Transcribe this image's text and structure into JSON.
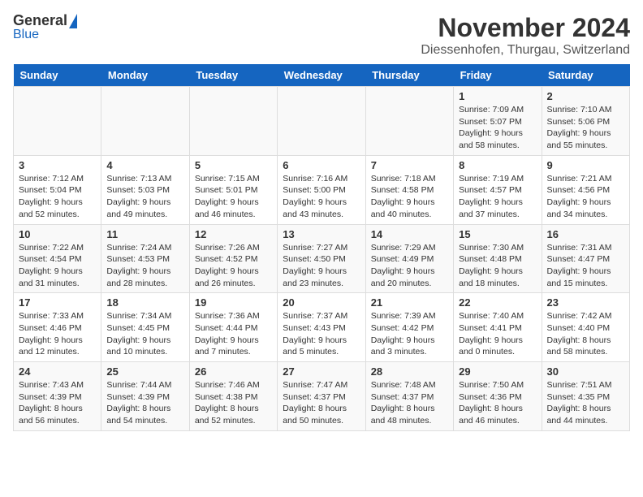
{
  "header": {
    "logo_general": "General",
    "logo_blue": "Blue",
    "month_title": "November 2024",
    "subtitle": "Diessenhofen, Thurgau, Switzerland"
  },
  "days_of_week": [
    "Sunday",
    "Monday",
    "Tuesday",
    "Wednesday",
    "Thursday",
    "Friday",
    "Saturday"
  ],
  "weeks": [
    [
      {
        "day": "",
        "info": ""
      },
      {
        "day": "",
        "info": ""
      },
      {
        "day": "",
        "info": ""
      },
      {
        "day": "",
        "info": ""
      },
      {
        "day": "",
        "info": ""
      },
      {
        "day": "1",
        "info": "Sunrise: 7:09 AM\nSunset: 5:07 PM\nDaylight: 9 hours and 58 minutes."
      },
      {
        "day": "2",
        "info": "Sunrise: 7:10 AM\nSunset: 5:06 PM\nDaylight: 9 hours and 55 minutes."
      }
    ],
    [
      {
        "day": "3",
        "info": "Sunrise: 7:12 AM\nSunset: 5:04 PM\nDaylight: 9 hours and 52 minutes."
      },
      {
        "day": "4",
        "info": "Sunrise: 7:13 AM\nSunset: 5:03 PM\nDaylight: 9 hours and 49 minutes."
      },
      {
        "day": "5",
        "info": "Sunrise: 7:15 AM\nSunset: 5:01 PM\nDaylight: 9 hours and 46 minutes."
      },
      {
        "day": "6",
        "info": "Sunrise: 7:16 AM\nSunset: 5:00 PM\nDaylight: 9 hours and 43 minutes."
      },
      {
        "day": "7",
        "info": "Sunrise: 7:18 AM\nSunset: 4:58 PM\nDaylight: 9 hours and 40 minutes."
      },
      {
        "day": "8",
        "info": "Sunrise: 7:19 AM\nSunset: 4:57 PM\nDaylight: 9 hours and 37 minutes."
      },
      {
        "day": "9",
        "info": "Sunrise: 7:21 AM\nSunset: 4:56 PM\nDaylight: 9 hours and 34 minutes."
      }
    ],
    [
      {
        "day": "10",
        "info": "Sunrise: 7:22 AM\nSunset: 4:54 PM\nDaylight: 9 hours and 31 minutes."
      },
      {
        "day": "11",
        "info": "Sunrise: 7:24 AM\nSunset: 4:53 PM\nDaylight: 9 hours and 28 minutes."
      },
      {
        "day": "12",
        "info": "Sunrise: 7:26 AM\nSunset: 4:52 PM\nDaylight: 9 hours and 26 minutes."
      },
      {
        "day": "13",
        "info": "Sunrise: 7:27 AM\nSunset: 4:50 PM\nDaylight: 9 hours and 23 minutes."
      },
      {
        "day": "14",
        "info": "Sunrise: 7:29 AM\nSunset: 4:49 PM\nDaylight: 9 hours and 20 minutes."
      },
      {
        "day": "15",
        "info": "Sunrise: 7:30 AM\nSunset: 4:48 PM\nDaylight: 9 hours and 18 minutes."
      },
      {
        "day": "16",
        "info": "Sunrise: 7:31 AM\nSunset: 4:47 PM\nDaylight: 9 hours and 15 minutes."
      }
    ],
    [
      {
        "day": "17",
        "info": "Sunrise: 7:33 AM\nSunset: 4:46 PM\nDaylight: 9 hours and 12 minutes."
      },
      {
        "day": "18",
        "info": "Sunrise: 7:34 AM\nSunset: 4:45 PM\nDaylight: 9 hours and 10 minutes."
      },
      {
        "day": "19",
        "info": "Sunrise: 7:36 AM\nSunset: 4:44 PM\nDaylight: 9 hours and 7 minutes."
      },
      {
        "day": "20",
        "info": "Sunrise: 7:37 AM\nSunset: 4:43 PM\nDaylight: 9 hours and 5 minutes."
      },
      {
        "day": "21",
        "info": "Sunrise: 7:39 AM\nSunset: 4:42 PM\nDaylight: 9 hours and 3 minutes."
      },
      {
        "day": "22",
        "info": "Sunrise: 7:40 AM\nSunset: 4:41 PM\nDaylight: 9 hours and 0 minutes."
      },
      {
        "day": "23",
        "info": "Sunrise: 7:42 AM\nSunset: 4:40 PM\nDaylight: 8 hours and 58 minutes."
      }
    ],
    [
      {
        "day": "24",
        "info": "Sunrise: 7:43 AM\nSunset: 4:39 PM\nDaylight: 8 hours and 56 minutes."
      },
      {
        "day": "25",
        "info": "Sunrise: 7:44 AM\nSunset: 4:39 PM\nDaylight: 8 hours and 54 minutes."
      },
      {
        "day": "26",
        "info": "Sunrise: 7:46 AM\nSunset: 4:38 PM\nDaylight: 8 hours and 52 minutes."
      },
      {
        "day": "27",
        "info": "Sunrise: 7:47 AM\nSunset: 4:37 PM\nDaylight: 8 hours and 50 minutes."
      },
      {
        "day": "28",
        "info": "Sunrise: 7:48 AM\nSunset: 4:37 PM\nDaylight: 8 hours and 48 minutes."
      },
      {
        "day": "29",
        "info": "Sunrise: 7:50 AM\nSunset: 4:36 PM\nDaylight: 8 hours and 46 minutes."
      },
      {
        "day": "30",
        "info": "Sunrise: 7:51 AM\nSunset: 4:35 PM\nDaylight: 8 hours and 44 minutes."
      }
    ]
  ]
}
